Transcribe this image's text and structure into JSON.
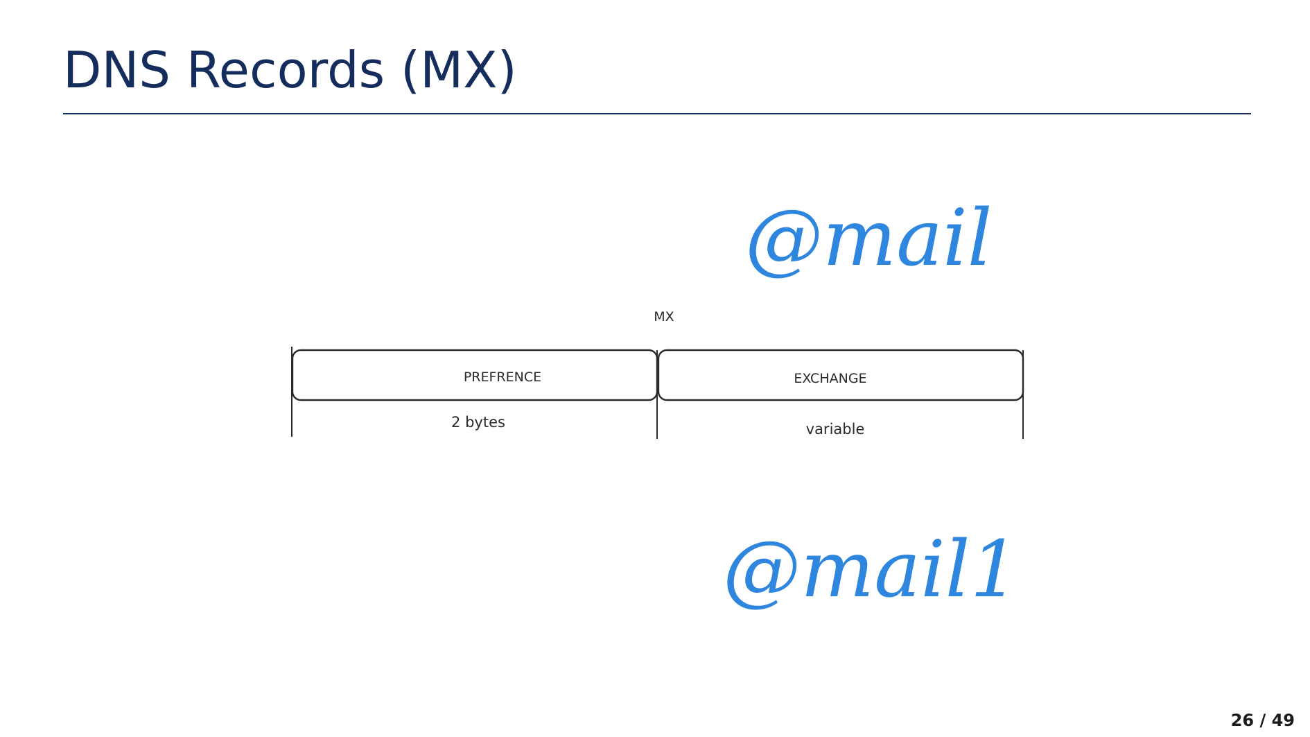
{
  "slide": {
    "title": "DNS Records (MX)",
    "page_current": "26",
    "page_separator": "/",
    "page_total": "49"
  },
  "diagram": {
    "record_label": "MX",
    "fields": [
      {
        "name": "PREFRENCE",
        "size": "2 bytes"
      },
      {
        "name": "EXCHANGE",
        "size": "variable"
      }
    ]
  },
  "annotations": {
    "top_note": "@mail",
    "bottom_note": "@mail1",
    "ink_color": "#2e86de"
  }
}
